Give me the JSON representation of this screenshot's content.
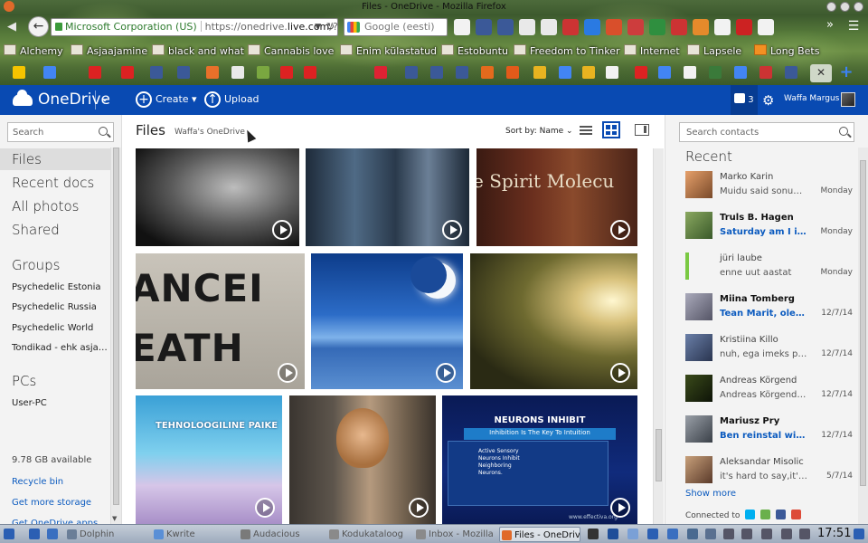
{
  "browser": {
    "window_title": "Files - OneDrive - Mozilla Firefox",
    "identity": "Microsoft Corporation (US)",
    "url_prefix": "https://onedrive.",
    "url_domain": "live.com",
    "url_suffix": "/?cid=",
    "search_engine": "Google (eesti)",
    "bookmarks": [
      "Alchemy",
      "Asjaajamine",
      "black and what",
      "Cannabis love",
      "Enim külastatud",
      "Estobuntu",
      "Freedom to Tinker",
      "Internet",
      "Lapsele",
      "Long Bets"
    ]
  },
  "onedrive": {
    "brand": "OneDrive",
    "create_label": "Create",
    "upload_label": "Upload",
    "notification_count": "3",
    "user_name": "Waffa Margus",
    "accent": "#094ab2"
  },
  "left_nav": {
    "search_placeholder": "Search",
    "items": [
      "Files",
      "Recent docs",
      "All photos",
      "Shared"
    ],
    "groups_title": "Groups",
    "groups": [
      "Psychedelic Estonia",
      "Psychedelic Russia",
      "Psychedelic World",
      "Tondikad - ehk asjad ..."
    ],
    "pcs_title": "PCs",
    "pcs": [
      "User-PC"
    ],
    "storage": "9.78 GB available",
    "recycle_bin": "Recycle bin",
    "get_storage": "Get more storage",
    "get_apps": "Get OneDrive apps"
  },
  "main": {
    "title": "Files",
    "subtitle": "Waffa's OneDrive",
    "sort_label": "Sort by: Name",
    "tile_texts": {
      "spirit": "e Spirit Molecu",
      "cancer_1": "ANCEI",
      "cancer_2": "EATH",
      "techno_1": "TEHNOLOOGILINE PAIKE",
      "neurons_title": "NEURONS INHIBIT",
      "neurons_sub": "Inhibition Is The Key To Intuition",
      "neurons_box": "Active Sensory Neurons Inhibit Neighboring Neurons.",
      "neurons_url": "www.effectiva.org"
    }
  },
  "contacts": {
    "search_placeholder": "Search contacts",
    "recent_title": "Recent",
    "items": [
      {
        "name": "Marko Karin",
        "msg": "Muidu said sonumi...",
        "time": "Monday",
        "unread": false
      },
      {
        "name": "Truls B. Hagen",
        "msg": "Saturday am I in H...",
        "time": "Monday",
        "unread": true
      },
      {
        "name": "jüri laube",
        "msg": "enne uut aastat",
        "time": "Monday",
        "unread": false
      },
      {
        "name": "Miina Tomberg",
        "msg": "Tean Marit, olen lu...",
        "time": "12/7/14",
        "unread": true
      },
      {
        "name": "Kristiina Killo",
        "msg": "nuh, ega imeks pol...",
        "time": "12/7/14",
        "unread": false
      },
      {
        "name": "Andreas Körgend",
        "msg": "Andreas Körgend s...",
        "time": "12/7/14",
        "unread": false
      },
      {
        "name": "Mariusz Pry",
        "msg": "Ben reinstal windo...",
        "time": "12/7/14",
        "unread": true
      },
      {
        "name": "Aleksandar Misolic",
        "msg": "it's hard to say,it's ...",
        "time": "5/7/14",
        "unread": false
      }
    ],
    "show_more": "Show more",
    "connected_to": "Connected to"
  },
  "taskbar": {
    "items": [
      "Dolphin",
      "Kwrite",
      "Audacious",
      "Kodukataloog",
      "Inbox - Mozilla",
      "Files - OneDrive"
    ],
    "clock": "17:51"
  }
}
